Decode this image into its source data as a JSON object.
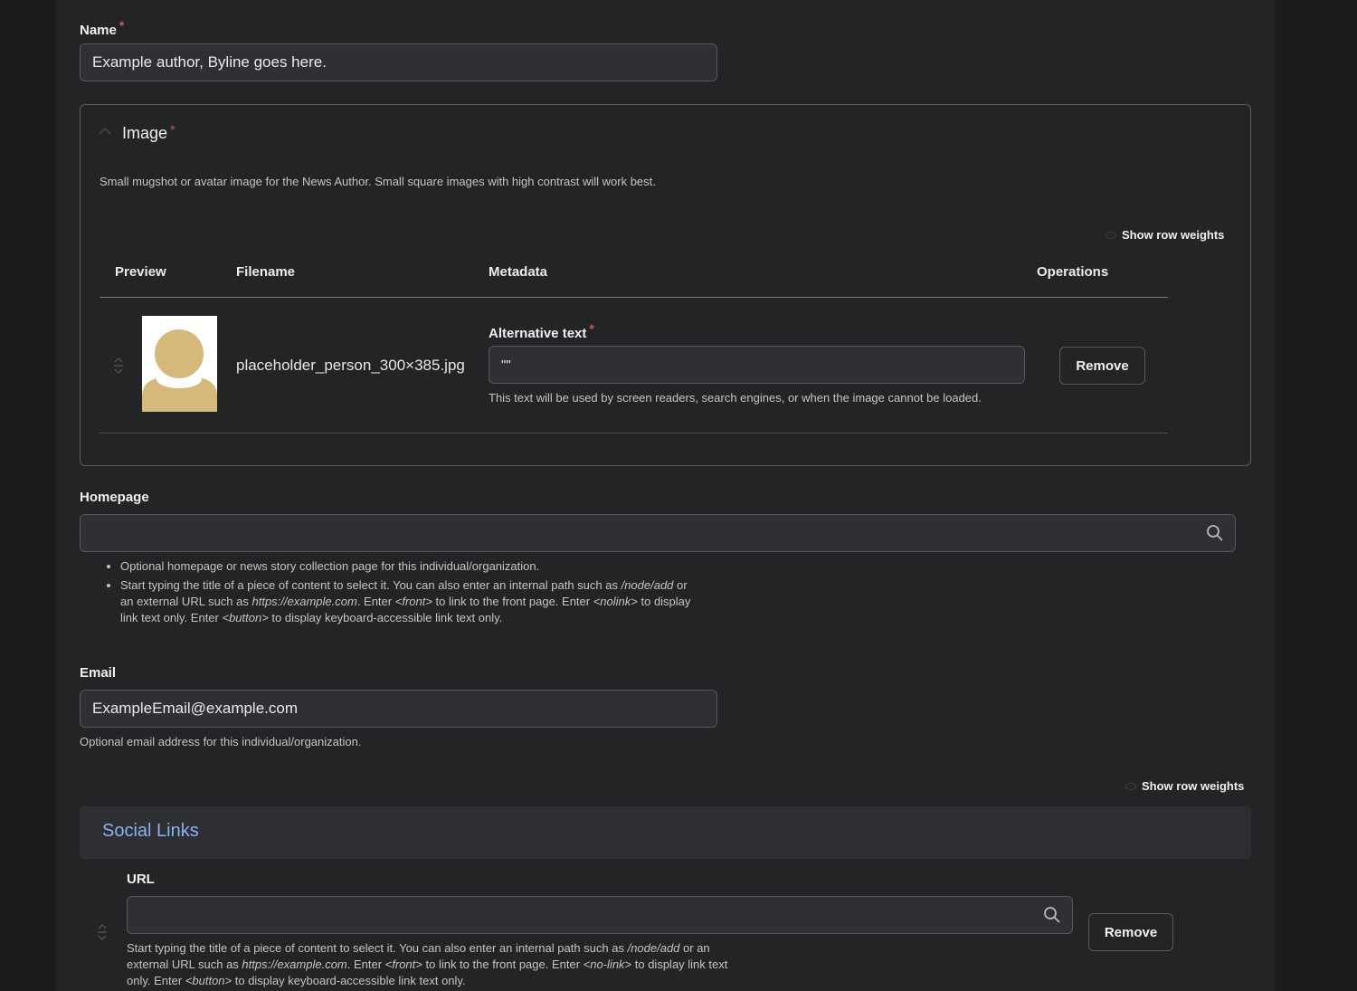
{
  "name_field": {
    "label": "Name",
    "value": "Example author, Byline goes here."
  },
  "image_section": {
    "title": "Image",
    "description": "Small mugshot or avatar image for the News Author. Small square images with high contrast will work best.",
    "show_row_weights": "Show row weights",
    "columns": [
      "Preview",
      "Filename",
      "Metadata",
      "Operations"
    ],
    "row": {
      "filename": "placeholder_person_300×385.jpg",
      "alt_label": "Alternative text",
      "alt_value": "\"\"",
      "alt_help": "This text will be used by screen readers, search engines, or when the image cannot be loaded.",
      "remove_label": "Remove"
    }
  },
  "homepage_field": {
    "label": "Homepage",
    "value": "",
    "help_1": "Optional homepage or news story collection page for this individual/organization.",
    "help_2": {
      "a": "Start typing the title of a piece of content to select it. You can also enter an internal path such as ",
      "b": "/node/add",
      "c": " or an external URL such as ",
      "d": "https://example.com",
      "e": ". Enter ",
      "f": "<front>",
      "g": " to link to the front page. Enter ",
      "h": "<nolink>",
      "i": " to display link text only. Enter ",
      "j": "<button>",
      "k": " to display keyboard-accessible link text only."
    }
  },
  "email_field": {
    "label": "Email",
    "value": "ExampleEmail@example.com",
    "help": "Optional email address for this individual/organization."
  },
  "social_links": {
    "show_row_weights": "Show row weights",
    "title": "Social Links",
    "url_label": "URL",
    "url_value": "",
    "help": {
      "a": "Start typing the title of a piece of content to select it. You can also enter an internal path such as ",
      "b": "/node/add",
      "c": " or an external URL such as ",
      "d": "https://example.com",
      "e": ". Enter ",
      "f": "<front>",
      "g": " to link to the front page. Enter ",
      "h": "<no-link>",
      "i": " to display link text only. Enter ",
      "j": "<button>",
      "k": " to display keyboard-accessible link text only."
    },
    "remove_label": "Remove"
  },
  "colors": {
    "page_bg": "#1b1c1e",
    "panel_bg": "#232426",
    "input_bg": "#2e3033",
    "required": "#d9534f",
    "link_title": "#8ab4f0",
    "avatar": "#d4b97b"
  }
}
